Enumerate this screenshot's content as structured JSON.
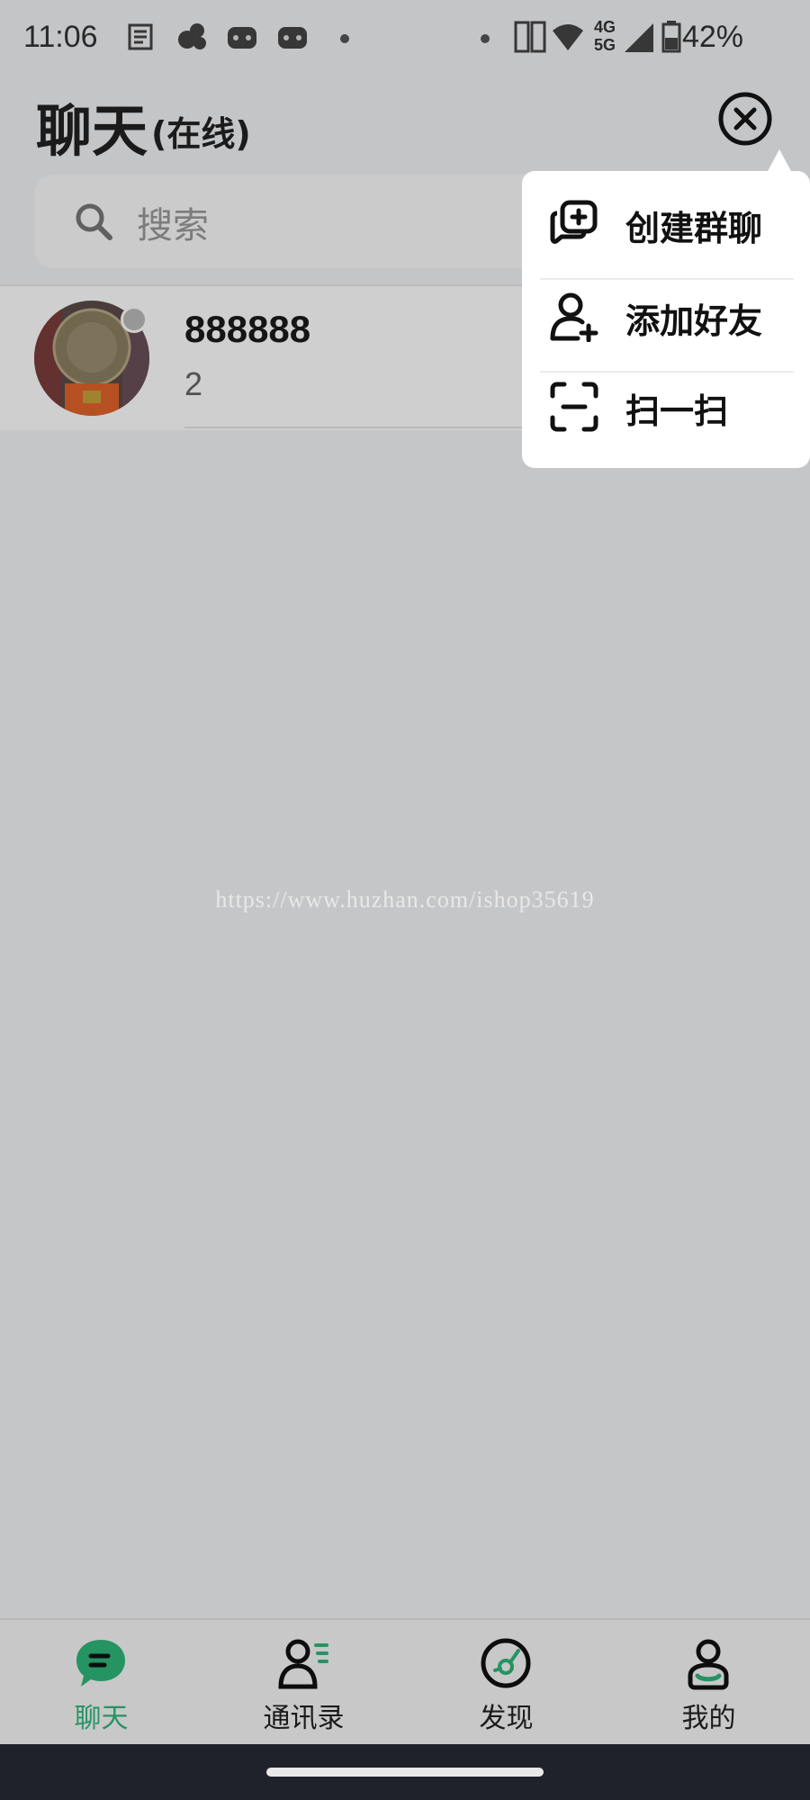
{
  "status_bar": {
    "time": "11:06",
    "network_top": "4G",
    "network_bottom": "5G",
    "battery": "42%"
  },
  "header": {
    "title": "聊天",
    "subtitle": "(在线)"
  },
  "search": {
    "placeholder": "搜索"
  },
  "chats": [
    {
      "name": "888888",
      "last_message": "2"
    }
  ],
  "popup_menu": {
    "items": [
      {
        "label": "创建群聊",
        "icon": "add-group-chat-icon"
      },
      {
        "label": "添加好友",
        "icon": "add-friend-icon"
      },
      {
        "label": "扫一扫",
        "icon": "scan-icon"
      }
    ]
  },
  "watermark": "https://www.huzhan.com/ishop35619",
  "tabbar": {
    "tabs": [
      {
        "label": "聊天",
        "icon": "chat-icon",
        "active": true
      },
      {
        "label": "通讯录",
        "icon": "contacts-icon",
        "active": false
      },
      {
        "label": "发现",
        "icon": "discover-icon",
        "active": false
      },
      {
        "label": "我的",
        "icon": "profile-icon",
        "active": false
      }
    ]
  },
  "colors": {
    "accent": "#2fb57a",
    "overlay": "rgba(0,0,0,0.19)"
  }
}
